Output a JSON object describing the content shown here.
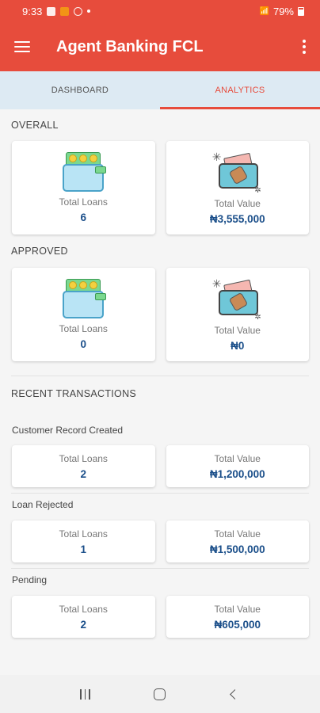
{
  "status_bar": {
    "time": "9:33",
    "battery": "79%"
  },
  "app_bar": {
    "title": "Agent Banking FCL"
  },
  "tabs": [
    {
      "label": "DASHBOARD",
      "active": false
    },
    {
      "label": "ANALYTICS",
      "active": true
    }
  ],
  "overall": {
    "title": "OVERALL",
    "loans_label": "Total Loans",
    "loans_value": "6",
    "value_label": "Total Value",
    "value_value": "₦3,555,000"
  },
  "approved": {
    "title": "APPROVED",
    "loans_label": "Total Loans",
    "loans_value": "0",
    "value_label": "Total Value",
    "value_value": "₦0"
  },
  "recent": {
    "title": "RECENT TRANSACTIONS",
    "groups": [
      {
        "label": "Customer Record Created",
        "loans_label": "Total Loans",
        "loans_value": "2",
        "value_label": "Total Value",
        "value_value": "₦1,200,000"
      },
      {
        "label": "Loan Rejected",
        "loans_label": "Total Loans",
        "loans_value": "1",
        "value_label": "Total Value",
        "value_value": "₦1,500,000"
      },
      {
        "label": "Pending",
        "loans_label": "Total Loans",
        "loans_value": "2",
        "value_label": "Total Value",
        "value_value": "₦605,000"
      }
    ]
  },
  "colors": {
    "accent": "#e74c3c",
    "tab_bg": "#ddeaf3",
    "value_text": "#1b4f8a"
  },
  "icons": [
    "menu-icon",
    "more-vert-icon",
    "wallet-icon",
    "phone-payment-icon",
    "recent-apps-icon",
    "home-icon",
    "back-icon"
  ]
}
